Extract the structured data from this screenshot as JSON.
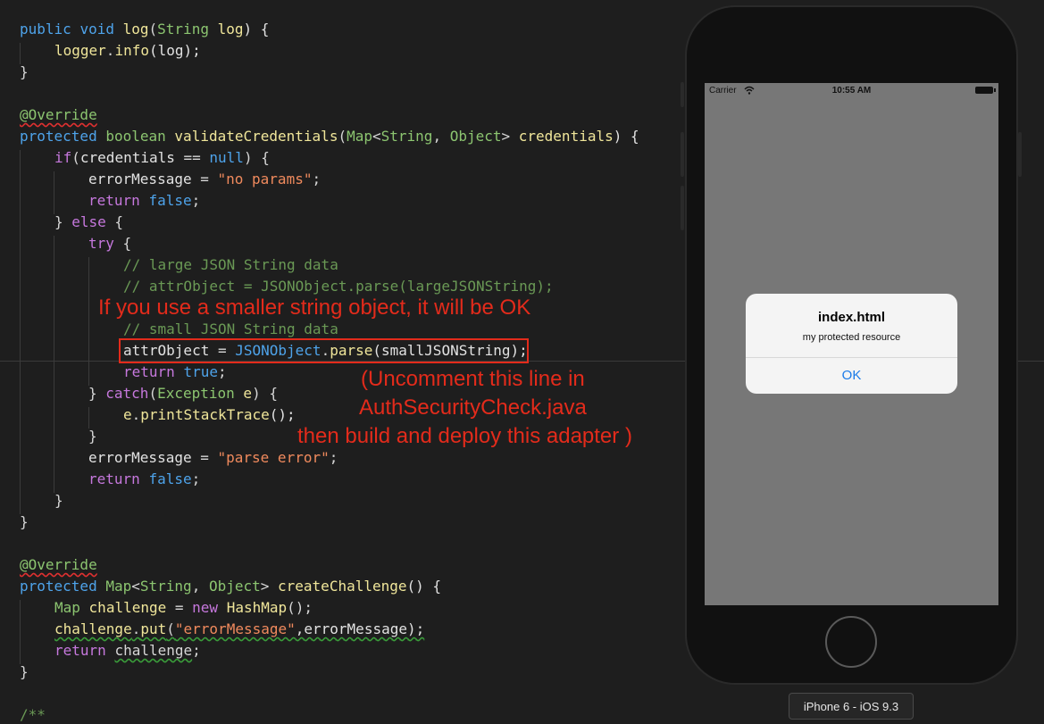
{
  "code": {
    "line1": {
      "kw1": "public",
      "kw2": "void",
      "fn": "log",
      "tp": "String",
      "p": "log",
      "end": ") {"
    },
    "line2": {
      "obj": "logger",
      "fn": "info",
      "rest": "(log);"
    },
    "line3": "}",
    "line5": "@Override",
    "line6": {
      "kw1": "protected",
      "kw2": "boolean",
      "fn": "validateCredentials",
      "tp1": "Map",
      "tp2": "String",
      "tp3": "Object",
      "p": "credentials",
      "end": ") {"
    },
    "line7": {
      "kw": "if",
      "v": "credentials",
      "op": " == ",
      "nul": "null",
      "end": ") {"
    },
    "line8": {
      "v": "errorMessage",
      "op": " = ",
      "str": "\"no params\"",
      "end": ";"
    },
    "line9": {
      "kw": "return",
      "val": "false",
      "end": ";"
    },
    "line10": {
      "start": "} ",
      "kw": "else",
      "end": " {"
    },
    "line11": {
      "kw": "try",
      "end": " {"
    },
    "line12": "// large JSON String data",
    "line13": "// attrObject = JSONObject.parse(largeJSONString);",
    "line14": "// small JSON String data",
    "line15": {
      "v": "attrObject",
      "op": " = ",
      "cls": "JSONObject",
      "fn": "parse",
      "rest": "(smallJSONString);"
    },
    "line16": {
      "kw": "return",
      "val": "true",
      "end": ";"
    },
    "line17": {
      "start": "} ",
      "kw": "catch",
      "tp": "Exception",
      "p": "e",
      "end": ") {"
    },
    "line18": {
      "obj": "e",
      "fn": "printStackTrace",
      "rest": "();"
    },
    "line19": "}",
    "line20": {
      "v": "errorMessage",
      "op": " = ",
      "str": "\"parse error\"",
      "end": ";"
    },
    "line21": {
      "kw": "return",
      "val": "false",
      "end": ";"
    },
    "line22": "}",
    "line23": "}",
    "line25": "@Override",
    "line26": {
      "kw1": "protected",
      "tp1": "Map",
      "tp2": "String",
      "tp3": "Object",
      "fn": "createChallenge",
      "end": "() {"
    },
    "line27": {
      "tp": "Map",
      "v": "challenge",
      "op": " = ",
      "kw": "new",
      "cls": "HashMap",
      "end": "();"
    },
    "line28": {
      "obj": "challenge",
      "fn": "put",
      "str": "\"errorMessage\"",
      "rest": ",errorMessage);"
    },
    "line29": {
      "kw": "return",
      "v": "challenge",
      "end": ";"
    },
    "line30": "}",
    "line32": "/**"
  },
  "annotations": {
    "smaller_string": "If you use a smaller string object, it will be OK",
    "uncomment_1": "(Uncomment this line in",
    "uncomment_2": "AuthSecurityCheck.java",
    "uncomment_3": "then build and deploy this adapter )"
  },
  "simulator": {
    "status": {
      "carrier": "Carrier",
      "time": "10:55 AM"
    },
    "alert": {
      "title": "index.html",
      "message": "my protected resource",
      "ok_label": "OK"
    },
    "device_label": "iPhone 6 - iOS 9.3"
  },
  "icons": {
    "wifi": "wifi-icon",
    "battery": "battery-icon",
    "home": "home-button-icon"
  }
}
